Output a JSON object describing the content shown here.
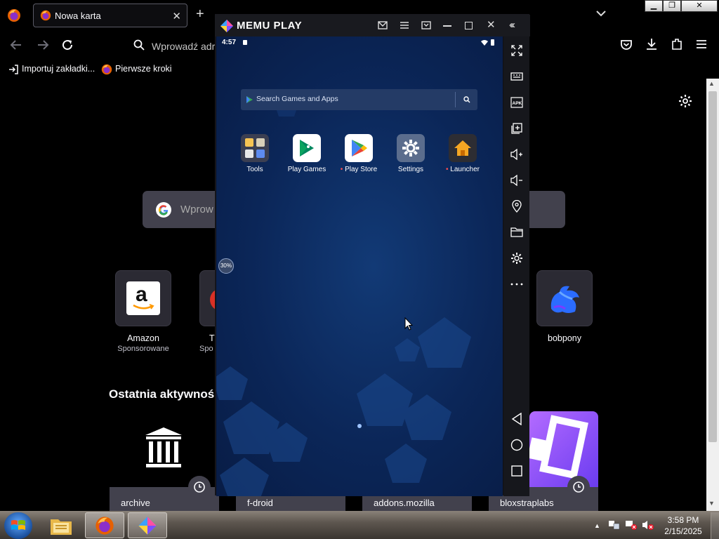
{
  "browser": {
    "tab_title": "Nowa karta",
    "url_placeholder": "Wprowadź adr",
    "bookmarks": [
      {
        "label": "Importuj zakładki..."
      },
      {
        "label": "Pierwsze kroki"
      }
    ],
    "search_placeholder": "Wprow",
    "shortcuts": [
      {
        "name": "Amazon",
        "sub": "Sponsorowane"
      },
      {
        "name": "T",
        "sub": "Spo"
      },
      {
        "name": "bobpony",
        "sub": ""
      }
    ],
    "recent_heading": "Ostatnia aktywność",
    "recent_cards": [
      "archive",
      "f-droid",
      "addons.mozilla",
      "bloxstraplabs"
    ]
  },
  "memu": {
    "title": "MEMU PLAY",
    "status_time": "4:57",
    "search_placeholder": "Search Games and Apps",
    "apps": [
      {
        "name": "Tools",
        "dot": false
      },
      {
        "name": "Play Games",
        "dot": false
      },
      {
        "name": "Play Store",
        "dot": true
      },
      {
        "name": "Settings",
        "dot": false
      },
      {
        "name": "Launcher",
        "dot": true
      }
    ],
    "progress_badge": "30%",
    "sidebar_icons": [
      "fullscreen-icon",
      "keyboard-icon",
      "apk-icon",
      "add-window-icon",
      "volume-up-icon",
      "volume-down-icon",
      "location-icon",
      "folder-icon",
      "settings-icon",
      "more-icon",
      "back-icon",
      "home-icon",
      "recents-icon"
    ]
  },
  "taskbar": {
    "time": "3:58 PM",
    "date": "2/15/2025"
  },
  "colors": {
    "browser_bg": "#000000",
    "tile_bg": "#2b2a33",
    "memu_screen": "#0b2658",
    "taskbar": "#5e5750"
  }
}
